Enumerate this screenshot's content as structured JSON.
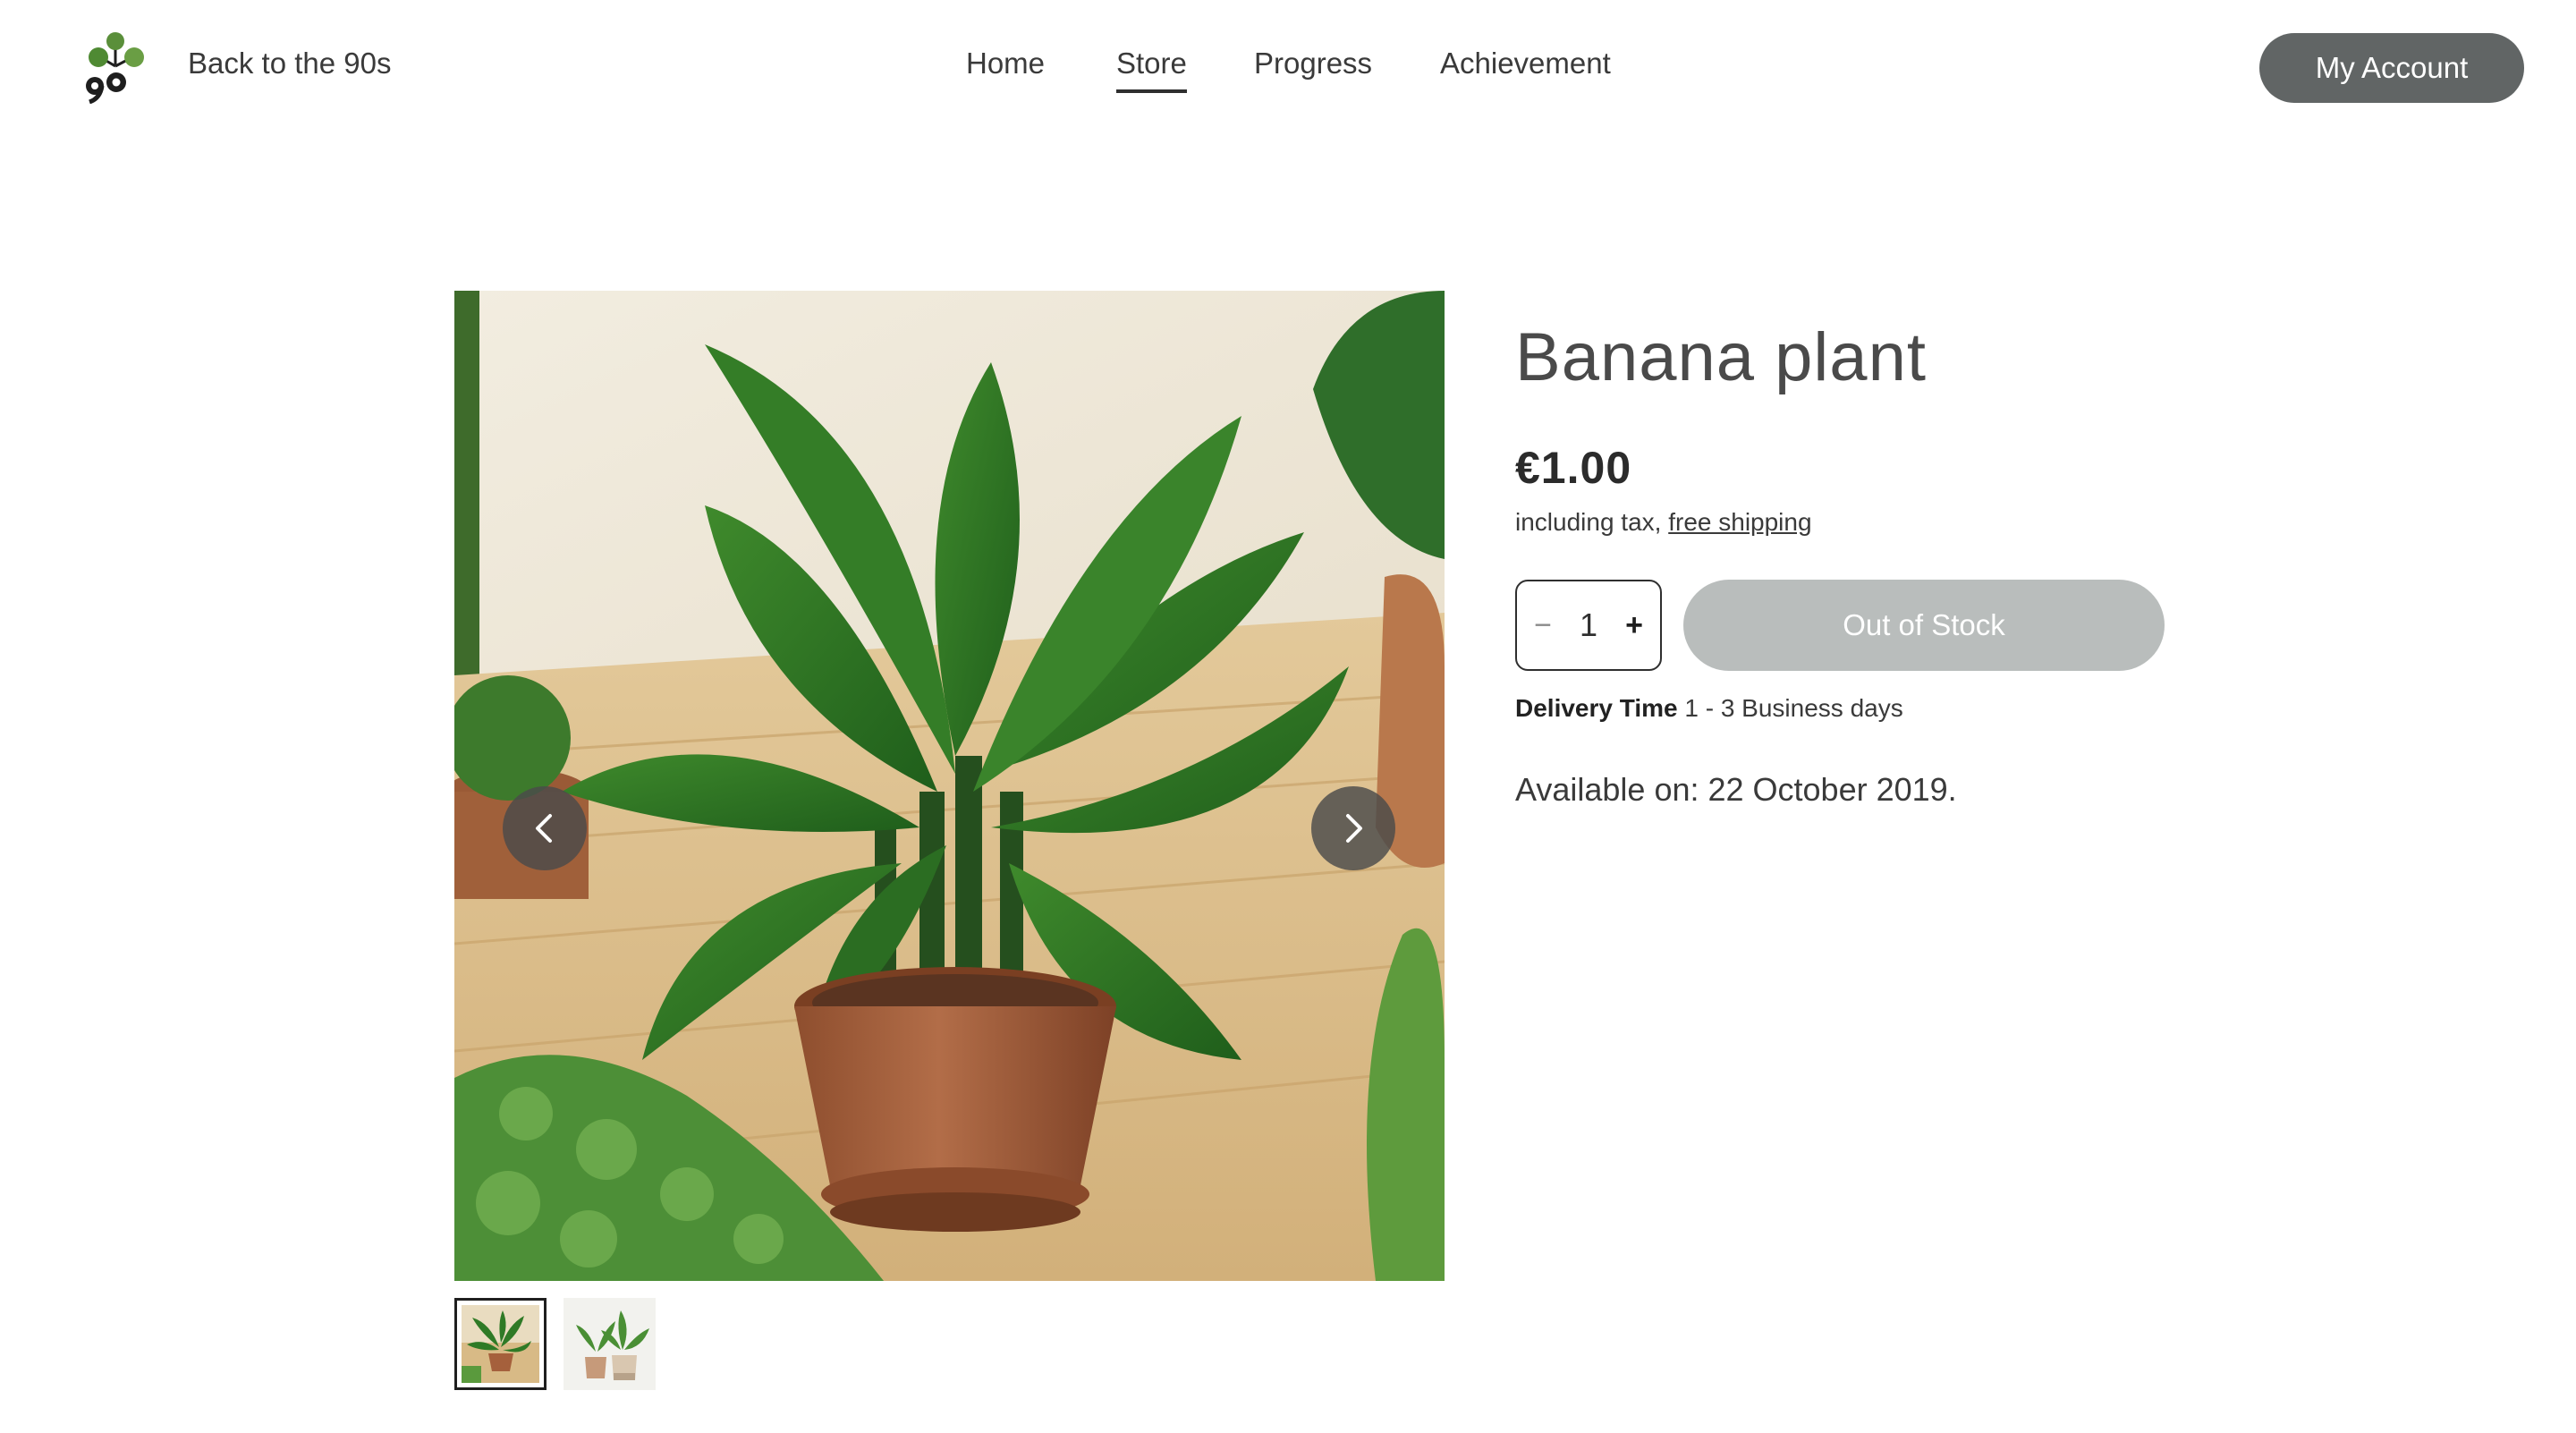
{
  "header": {
    "site_name": "Back to the 90s",
    "nav": [
      {
        "label": "Home",
        "active": false
      },
      {
        "label": "Store",
        "active": true
      },
      {
        "label": "Progress",
        "active": false
      },
      {
        "label": "Achievement",
        "active": false
      }
    ],
    "account_label": "My Account"
  },
  "gallery": {
    "prev_icon": "chevron-left-icon",
    "next_icon": "chevron-right-icon",
    "thumbnail_count": 2,
    "selected_thumbnail": 1
  },
  "product": {
    "title": "Banana plant",
    "price": "€1.00",
    "tax_prefix": "including tax, ",
    "shipping_link": "free shipping",
    "quantity": "1",
    "qty_minus": "−",
    "qty_plus": "+",
    "stock_label": "Out of Stock",
    "delivery_label": "Delivery Time",
    "delivery_value": " 1 - 3 Business days",
    "available": "Available on: 22 October 2019."
  },
  "colors": {
    "account_button": "#616565",
    "out_of_stock_button": "#b9bdbc",
    "text": "#2f2f2f"
  }
}
